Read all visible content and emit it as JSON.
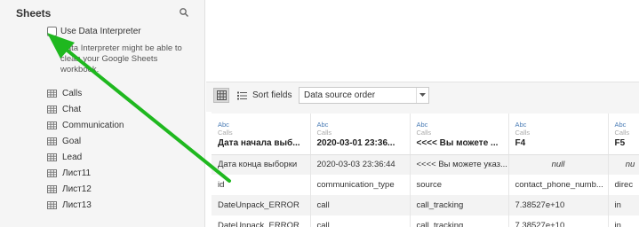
{
  "sidebar": {
    "title": "Sheets",
    "data_interpreter_label": "Use Data Interpreter",
    "data_interpreter_note": "Data Interpreter might be able to clean your Google Sheets workbook.",
    "sheets": [
      {
        "label": "Calls"
      },
      {
        "label": "Chat"
      },
      {
        "label": "Communication"
      },
      {
        "label": "Goal"
      },
      {
        "label": "Lead"
      },
      {
        "label": "Лист11"
      },
      {
        "label": "Лист12"
      },
      {
        "label": "Лист13"
      }
    ]
  },
  "toolbar": {
    "sort_label": "Sort fields",
    "sort_value": "Data source order"
  },
  "grid": {
    "columns": [
      {
        "type": "Abc",
        "source": "Calls",
        "name": "Дата начала выб..."
      },
      {
        "type": "Abc",
        "source": "Calls",
        "name": "2020-03-01 23:36..."
      },
      {
        "type": "Abc",
        "source": "Calls",
        "name": "<<<< Вы можете ..."
      },
      {
        "type": "Abc",
        "source": "Calls",
        "name": "F4"
      },
      {
        "type": "Abc",
        "source": "Calls",
        "name": "F5"
      }
    ],
    "rows": [
      [
        "Дата конца выборки",
        "2020-03-03 23:36:44",
        "<<<< Вы можете указ...",
        "null",
        "nu"
      ],
      [
        "id",
        "communication_type",
        "source",
        "contact_phone_numb...",
        "direc"
      ],
      [
        "DateUnpack_ERROR",
        "call",
        "call_tracking",
        "7.38527e+10",
        "in"
      ],
      [
        "DateUnpack_ERROR",
        "call",
        "call_tracking",
        "7.38527e+10",
        "in"
      ]
    ]
  },
  "colors": {
    "annotation_arrow": "#1fb81f",
    "type_label": "#4a7cb5"
  }
}
